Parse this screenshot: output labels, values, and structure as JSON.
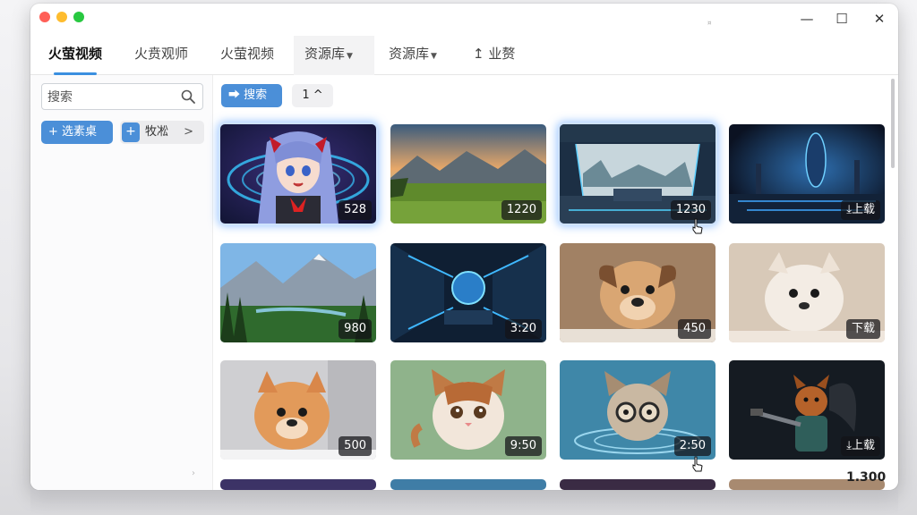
{
  "window": {
    "mark": "¤"
  },
  "controls": {
    "minimize": "—",
    "maximize": "☐",
    "close": "✕"
  },
  "tabs": [
    {
      "label": "火萤视频",
      "active": true
    },
    {
      "label": "火贲观师"
    },
    {
      "label": "火萤视频"
    },
    {
      "label": "资源库",
      "dropdown": true,
      "highlight": true
    },
    {
      "label": "资源库",
      "dropdown": true
    },
    {
      "label": "↥ 业赘"
    }
  ],
  "sidebar": {
    "search_placeholder": "搜索",
    "primary_button": "+ 选素桌",
    "secondary_button": {
      "plus": "+",
      "label": "牧凇",
      "chevron": ">"
    },
    "dots": [
      "›",
      "›"
    ]
  },
  "toolbar": {
    "search_button": "⮕ 搜索",
    "page_select": "1 ^"
  },
  "grid": {
    "items": [
      {
        "badge": "528",
        "scene": "anime",
        "selected": true
      },
      {
        "badge": "1220",
        "scene": "valley"
      },
      {
        "badge": "1230",
        "scene": "scifi-window",
        "selected": true
      },
      {
        "badge": "⤓上载",
        "scene": "scifi-dark"
      },
      {
        "badge": "980",
        "scene": "mountains"
      },
      {
        "badge": "3:20",
        "scene": "scifi-tunnel"
      },
      {
        "badge": "450",
        "scene": "puppy"
      },
      {
        "badge": "下载",
        "scene": "white-puppy"
      },
      {
        "badge": "500",
        "scene": "orange-puppy"
      },
      {
        "badge": "9:50",
        "scene": "kitten"
      },
      {
        "badge": "2:50",
        "scene": "glasses-cat"
      },
      {
        "badge": "⤓上载",
        "scene": "fox-warrior"
      }
    ]
  },
  "footer": {
    "count": "1.300"
  },
  "colors": {
    "accent": "#4b8fd8",
    "tab_underline": "#3a8fe0"
  }
}
